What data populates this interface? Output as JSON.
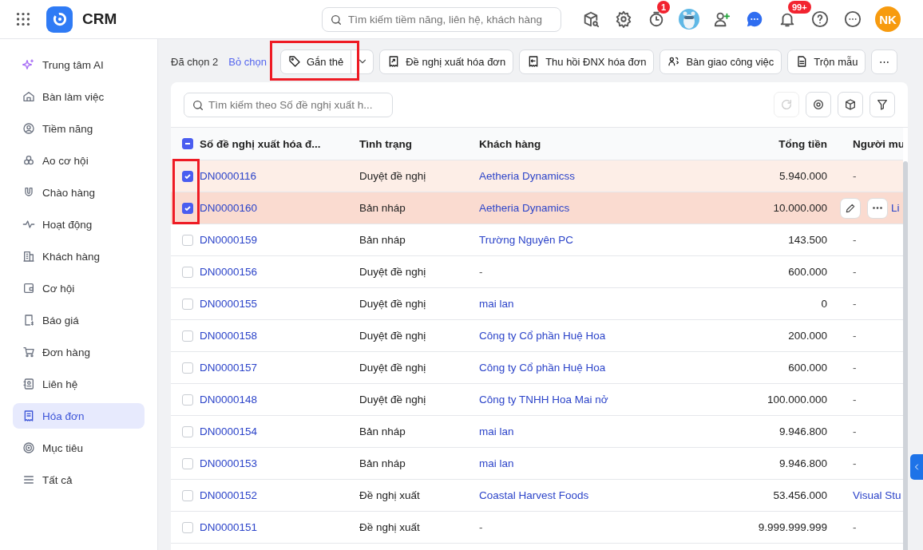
{
  "app": {
    "title": "CRM"
  },
  "search": {
    "placeholder": "Tìm kiếm tiềm năng, liên hệ, khách hàng"
  },
  "top_icons": [
    {
      "kind": "cube-search"
    },
    {
      "kind": "gear"
    },
    {
      "kind": "timer",
      "badge": "1"
    },
    {
      "kind": "picture"
    },
    {
      "kind": "add-user"
    },
    {
      "kind": "chat"
    },
    {
      "kind": "bell",
      "badge": "99+"
    },
    {
      "kind": "help"
    },
    {
      "kind": "more"
    },
    {
      "kind": "initials",
      "label": "NK"
    }
  ],
  "sidebar": {
    "items": [
      {
        "label": "Trung tâm AI",
        "selected": false
      },
      {
        "label": "Bàn làm việc",
        "selected": false
      },
      {
        "label": "Tiềm năng",
        "selected": false
      },
      {
        "label": "Ao cơ hội",
        "selected": false
      },
      {
        "label": "Chào hàng",
        "selected": false
      },
      {
        "label": "Hoạt động",
        "selected": false
      },
      {
        "label": "Khách hàng",
        "selected": false
      },
      {
        "label": "Cơ hội",
        "selected": false
      },
      {
        "label": "Báo giá",
        "selected": false
      },
      {
        "label": "Đơn hàng",
        "selected": false
      },
      {
        "label": "Liên hệ",
        "selected": false
      },
      {
        "label": "Hóa đơn",
        "selected": true
      },
      {
        "label": "Mục tiêu",
        "selected": false
      },
      {
        "label": "Tất cả",
        "selected": false
      }
    ]
  },
  "action_bar": {
    "selected_count": "Đã chọn 2",
    "deselect": "Bỏ chọn",
    "actions": [
      {
        "label": "Gắn thẻ",
        "dropdown": true,
        "highlighted": true
      },
      {
        "label": "Đề nghị xuất hóa đơn",
        "dropdown": false,
        "highlighted": false
      },
      {
        "label": "Thu hồi ĐNX hóa đơn",
        "dropdown": false,
        "highlighted": false
      },
      {
        "label": "Bàn giao công việc",
        "dropdown": false,
        "highlighted": false
      },
      {
        "label": "Trộn mẫu",
        "dropdown": false,
        "highlighted": false
      }
    ],
    "more": "⋯"
  },
  "table": {
    "search_placeholder": "Tìm kiếm theo Số đề nghị xuất h...",
    "checkbox_frame": true,
    "select_all_indeterminate": true,
    "columns": [
      "Số đề nghị xuất hóa đ...",
      "Tình trạng",
      "Khách hàng",
      "Tổng tiền",
      "Người mu"
    ],
    "rows": [
      {
        "number": "DN0000116",
        "status": "Duyệt đề nghị",
        "customer": "Aetheria Dynamicss",
        "total": "5.940.000",
        "buyer": "-",
        "selected": true,
        "hovered": false
      },
      {
        "number": "DN0000160",
        "status": "Bản nháp",
        "customer": "Aetheria Dynamics",
        "total": "10.000.000",
        "buyer": "Li",
        "selected": true,
        "hovered": true
      },
      {
        "number": "DN0000159",
        "status": "Bản nháp",
        "customer": "Trường Nguyên PC",
        "total": "143.500",
        "buyer": "-",
        "selected": false,
        "hovered": false
      },
      {
        "number": "DN0000156",
        "status": "Duyệt đề nghị",
        "customer": "-",
        "total": "600.000",
        "buyer": "-",
        "selected": false,
        "hovered": false
      },
      {
        "number": "DN0000155",
        "status": "Duyệt đề nghị",
        "customer": "mai lan",
        "total": "0",
        "buyer": "-",
        "selected": false,
        "hovered": false
      },
      {
        "number": "DN0000158",
        "status": "Duyệt đề nghị",
        "customer": "Công ty Cổ phần Huệ Hoa",
        "total": "200.000",
        "buyer": "-",
        "selected": false,
        "hovered": false
      },
      {
        "number": "DN0000157",
        "status": "Duyệt đề nghị",
        "customer": "Công ty Cổ phần Huệ Hoa",
        "total": "600.000",
        "buyer": "-",
        "selected": false,
        "hovered": false
      },
      {
        "number": "DN0000148",
        "status": "Duyệt đề nghị",
        "customer": "Công ty TNHH Hoa Mai nở",
        "total": "100.000.000",
        "buyer": "-",
        "selected": false,
        "hovered": false
      },
      {
        "number": "DN0000154",
        "status": "Bản nháp",
        "customer": "mai lan",
        "total": "9.946.800",
        "buyer": "-",
        "selected": false,
        "hovered": false
      },
      {
        "number": "DN0000153",
        "status": "Bản nháp",
        "customer": "mai lan",
        "total": "9.946.800",
        "buyer": "-",
        "selected": false,
        "hovered": false
      },
      {
        "number": "DN0000152",
        "status": "Đề nghị xuất",
        "customer": "Coastal Harvest Foods",
        "total": "53.456.000",
        "buyer": "Visual Stu",
        "selected": false,
        "hovered": false
      },
      {
        "number": "DN0000151",
        "status": "Đề nghị xuất",
        "customer": "-",
        "total": "9.999.999.999",
        "buyer": "-",
        "selected": false,
        "hovered": false
      }
    ]
  }
}
